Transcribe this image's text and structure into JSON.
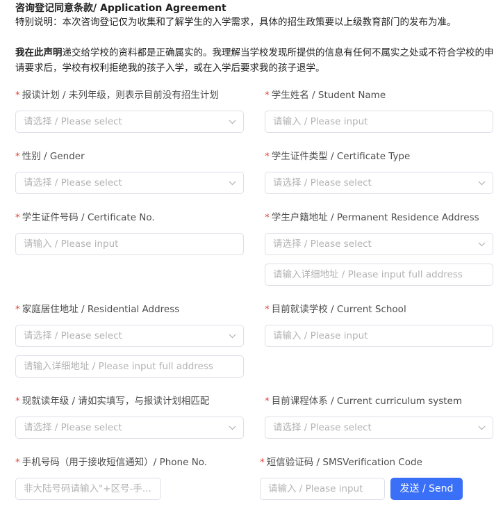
{
  "agreement": {
    "title": "咨询登记同意条款/ Application Agreement",
    "note": "特别说明：本次咨询登记仅为收集和了解学生的入学需求，具体的招生政策要以上级教育部门的发布为准。",
    "declare_bold": "我在此声明",
    "declare_text": "递交给学校的资料都是正确属实的。我理解当学校发现所提供的信息有任何不属实之处或不符合学校的申请要求后，学校有权利拒绝我的孩子入学，或在入学后要求我的孩子退学。"
  },
  "form": {
    "required_mark": "*",
    "plan_label": "报读计划 / 未列年级，则表示目前没有招生计划",
    "name_label": "学生姓名 / Student Name",
    "gender_label": "性别 / Gender",
    "cert_type_label": "学生证件类型 / Certificate Type",
    "cert_no_label": "学生证件号码 / Certificate No.",
    "residence_label": "学生户籍地址 / Permanent Residence Address",
    "home_label": "家庭居住地址 / Residential Address",
    "school_label": "目前就读学校 / Current School",
    "grade_label": "现就读年级 / 请如实填写，与报读计划相匹配",
    "curriculum_label": "目前课程体系 / Current curriculum system",
    "phone_label": "手机号码（用于接收短信通知）/ Phone No.",
    "sms_label": "短信验证码 / SMSVerification Code",
    "select_ph": "请选择 / Please select",
    "input_ph": "请输入 / Please input",
    "address_ph": "请输入详细地址 / Please input full address",
    "phone_ph": "非大陆号码请输入\"+区号-手...",
    "send_label": "发送 / Send"
  },
  "icons": {
    "chevron": "chevron-down-icon"
  },
  "colors": {
    "required": "#e0453a",
    "primary": "#3a6ff7",
    "border": "#dcdfe6",
    "placeholder": "#b3b3b3"
  }
}
